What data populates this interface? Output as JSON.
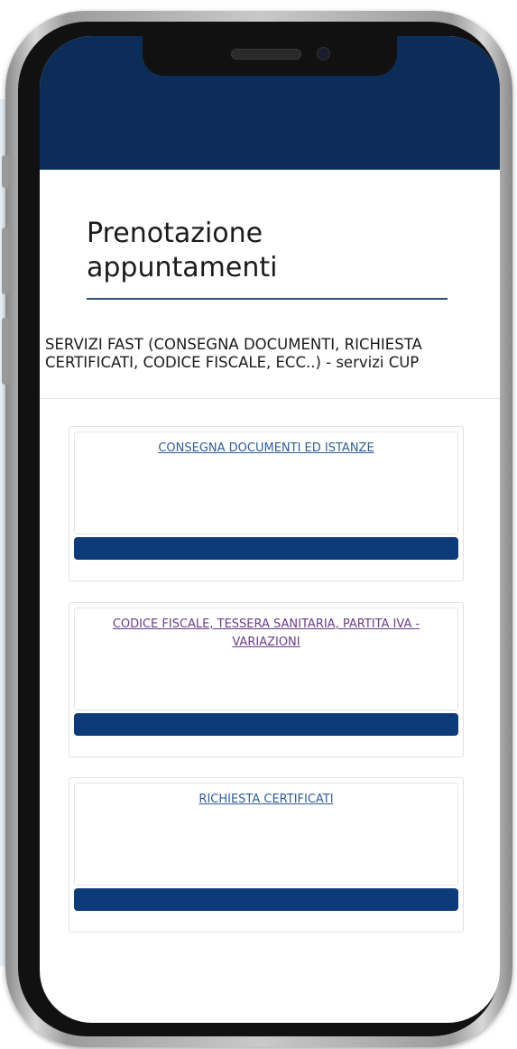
{
  "page": {
    "title": "Prenotazione appuntamenti"
  },
  "section": {
    "heading": "SERVIZI FAST (CONSEGNA DOCUMENTI, RICHIESTA CERTIFICATI, CODICE FISCALE, ECC..) - servizi CUP"
  },
  "services": [
    {
      "label": "CONSEGNA DOCUMENTI ED ISTANZE",
      "button_label": ""
    },
    {
      "label": "CODICE FISCALE, TESSERA SANITARIA, PARTITA IVA - VARIAZIONI",
      "button_label": ""
    },
    {
      "label": "RICHIESTA CERTIFICATI",
      "button_label": ""
    }
  ],
  "colors": {
    "header": "#0d2d58",
    "button": "#0d3a78",
    "link": "#2f5d99",
    "visited_link": "#6a3d8a"
  }
}
